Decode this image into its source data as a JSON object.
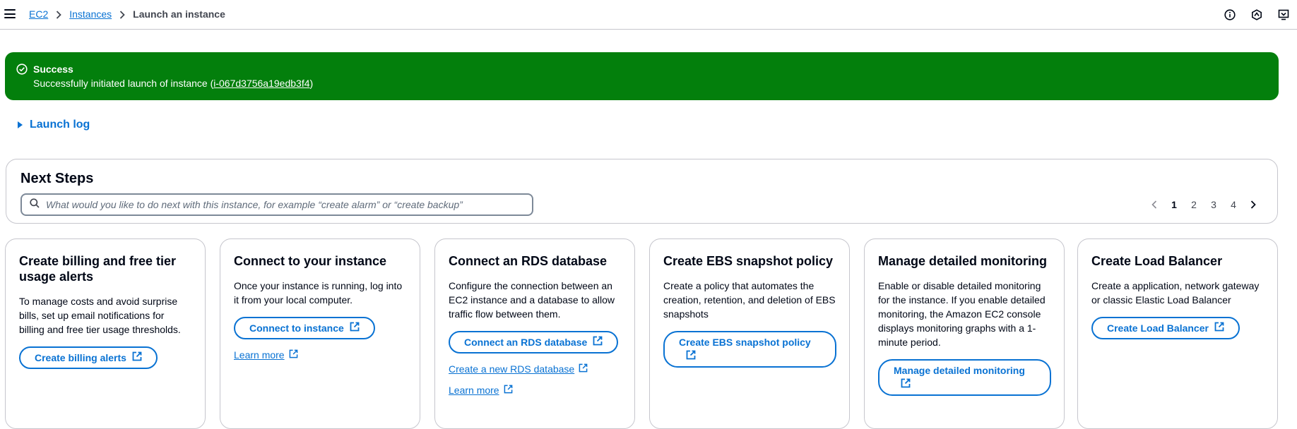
{
  "breadcrumb": {
    "items": [
      "EC2",
      "Instances"
    ],
    "current": "Launch an instance"
  },
  "top_icons": [
    "info-icon",
    "notifications-icon",
    "feedback-icon"
  ],
  "flash": {
    "header": "Success",
    "message_prefix": "Successfully initiated launch of instance (",
    "instance_id": "i-067d3756a19edb3f4",
    "message_suffix": ")",
    "color": "#037f0c"
  },
  "launch_log": {
    "label": "Launch log"
  },
  "next_steps": {
    "title": "Next Steps",
    "search_placeholder": "What would you like to do next with this instance, for example “create alarm” or “create backup”",
    "pages": [
      "1",
      "2",
      "3",
      "4"
    ],
    "current_page": "1"
  },
  "cards": [
    {
      "title": "Create billing and free tier usage alerts",
      "description": "To manage costs and avoid surprise bills, set up email notifications for billing and free tier usage thresholds.",
      "button": "Create billing alerts"
    },
    {
      "title": "Connect to your instance",
      "description": "Once your instance is running, log into it from your local computer.",
      "button": "Connect to instance",
      "link": "Learn more"
    },
    {
      "title": "Connect an RDS database",
      "description": "Configure the connection between an EC2 instance and a database to allow traffic flow between them.",
      "button": "Connect an RDS database",
      "link": "Create a new RDS database",
      "link2": "Learn more"
    },
    {
      "title": "Create EBS snapshot policy",
      "description": "Create a policy that automates the creation, retention, and deletion of EBS snapshots",
      "button": "Create EBS snapshot policy"
    },
    {
      "title": "Manage detailed monitoring",
      "description": "Enable or disable detailed monitoring for the instance. If you enable detailed monitoring, the Amazon EC2 console displays monitoring graphs with a 1-minute period.",
      "button": "Manage detailed monitoring"
    },
    {
      "title": "Create Load Balancer",
      "description": "Create a application, network gateway or classic Elastic Load Balancer",
      "button": "Create Load Balancer"
    }
  ],
  "colors": {
    "link": "#0972d3",
    "success": "#037f0c",
    "border": "#c6c6cd"
  }
}
